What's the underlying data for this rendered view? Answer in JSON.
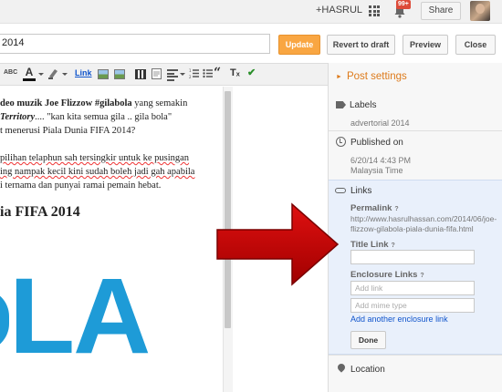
{
  "topbar": {
    "user": "+HASRUL",
    "notification_count": "99+",
    "share_label": "Share"
  },
  "titlebar": {
    "title_value": "2014",
    "update_label": "Update",
    "revert_label": "Revert to draft",
    "preview_label": "Preview",
    "close_label": "Close"
  },
  "toolbar": {
    "link_label": "Link",
    "spell_label": "ABC"
  },
  "editor": {
    "line1_bold": "deo muzik Joe Flizzow #gilabola",
    "line1_rest": " yang semakin",
    "line2_ital": " Territory",
    "line2_rest": ".... \"kan kita semua gila .. gila bola\"",
    "line3": "t menerusi Piala Dunia FIFA 2014?",
    "line4": "pilihan telaphun sah tersingkir untuk ke pusingan",
    "line5": "ing nampak kecil kini sudah boleh jadi gah apabila",
    "line6": "i ternama dan punyai ramai pemain hebat.",
    "heading": "ia FIFA 2014",
    "logo_text": "LA"
  },
  "sidebar": {
    "title": "Post settings",
    "labels_heading": "Labels",
    "labels_value": "advertorial 2014",
    "published_heading": "Published on",
    "published_date": "6/20/14 4:43 PM",
    "published_tz": "Malaysia Time",
    "links_heading": "Links",
    "permalink_label": "Permalink",
    "permalink_value": "http://www.hasrulhassan.com/2014/06/joe-flizzow-gilabola-piala-dunia-fifa.html",
    "title_link_label": "Title Link",
    "enclosure_label": "Enclosure Links",
    "add_link_placeholder": "Add link",
    "mime_placeholder": "Add mime type",
    "add_enclosure_label": "Add another enclosure link",
    "done_label": "Done",
    "location_heading": "Location",
    "help_mark": "?"
  },
  "colors": {
    "accent_orange": "#f9a642",
    "link_blue": "#1155cc",
    "arrow_red": "#cc0000",
    "logo_blue": "#1e9bd7"
  }
}
